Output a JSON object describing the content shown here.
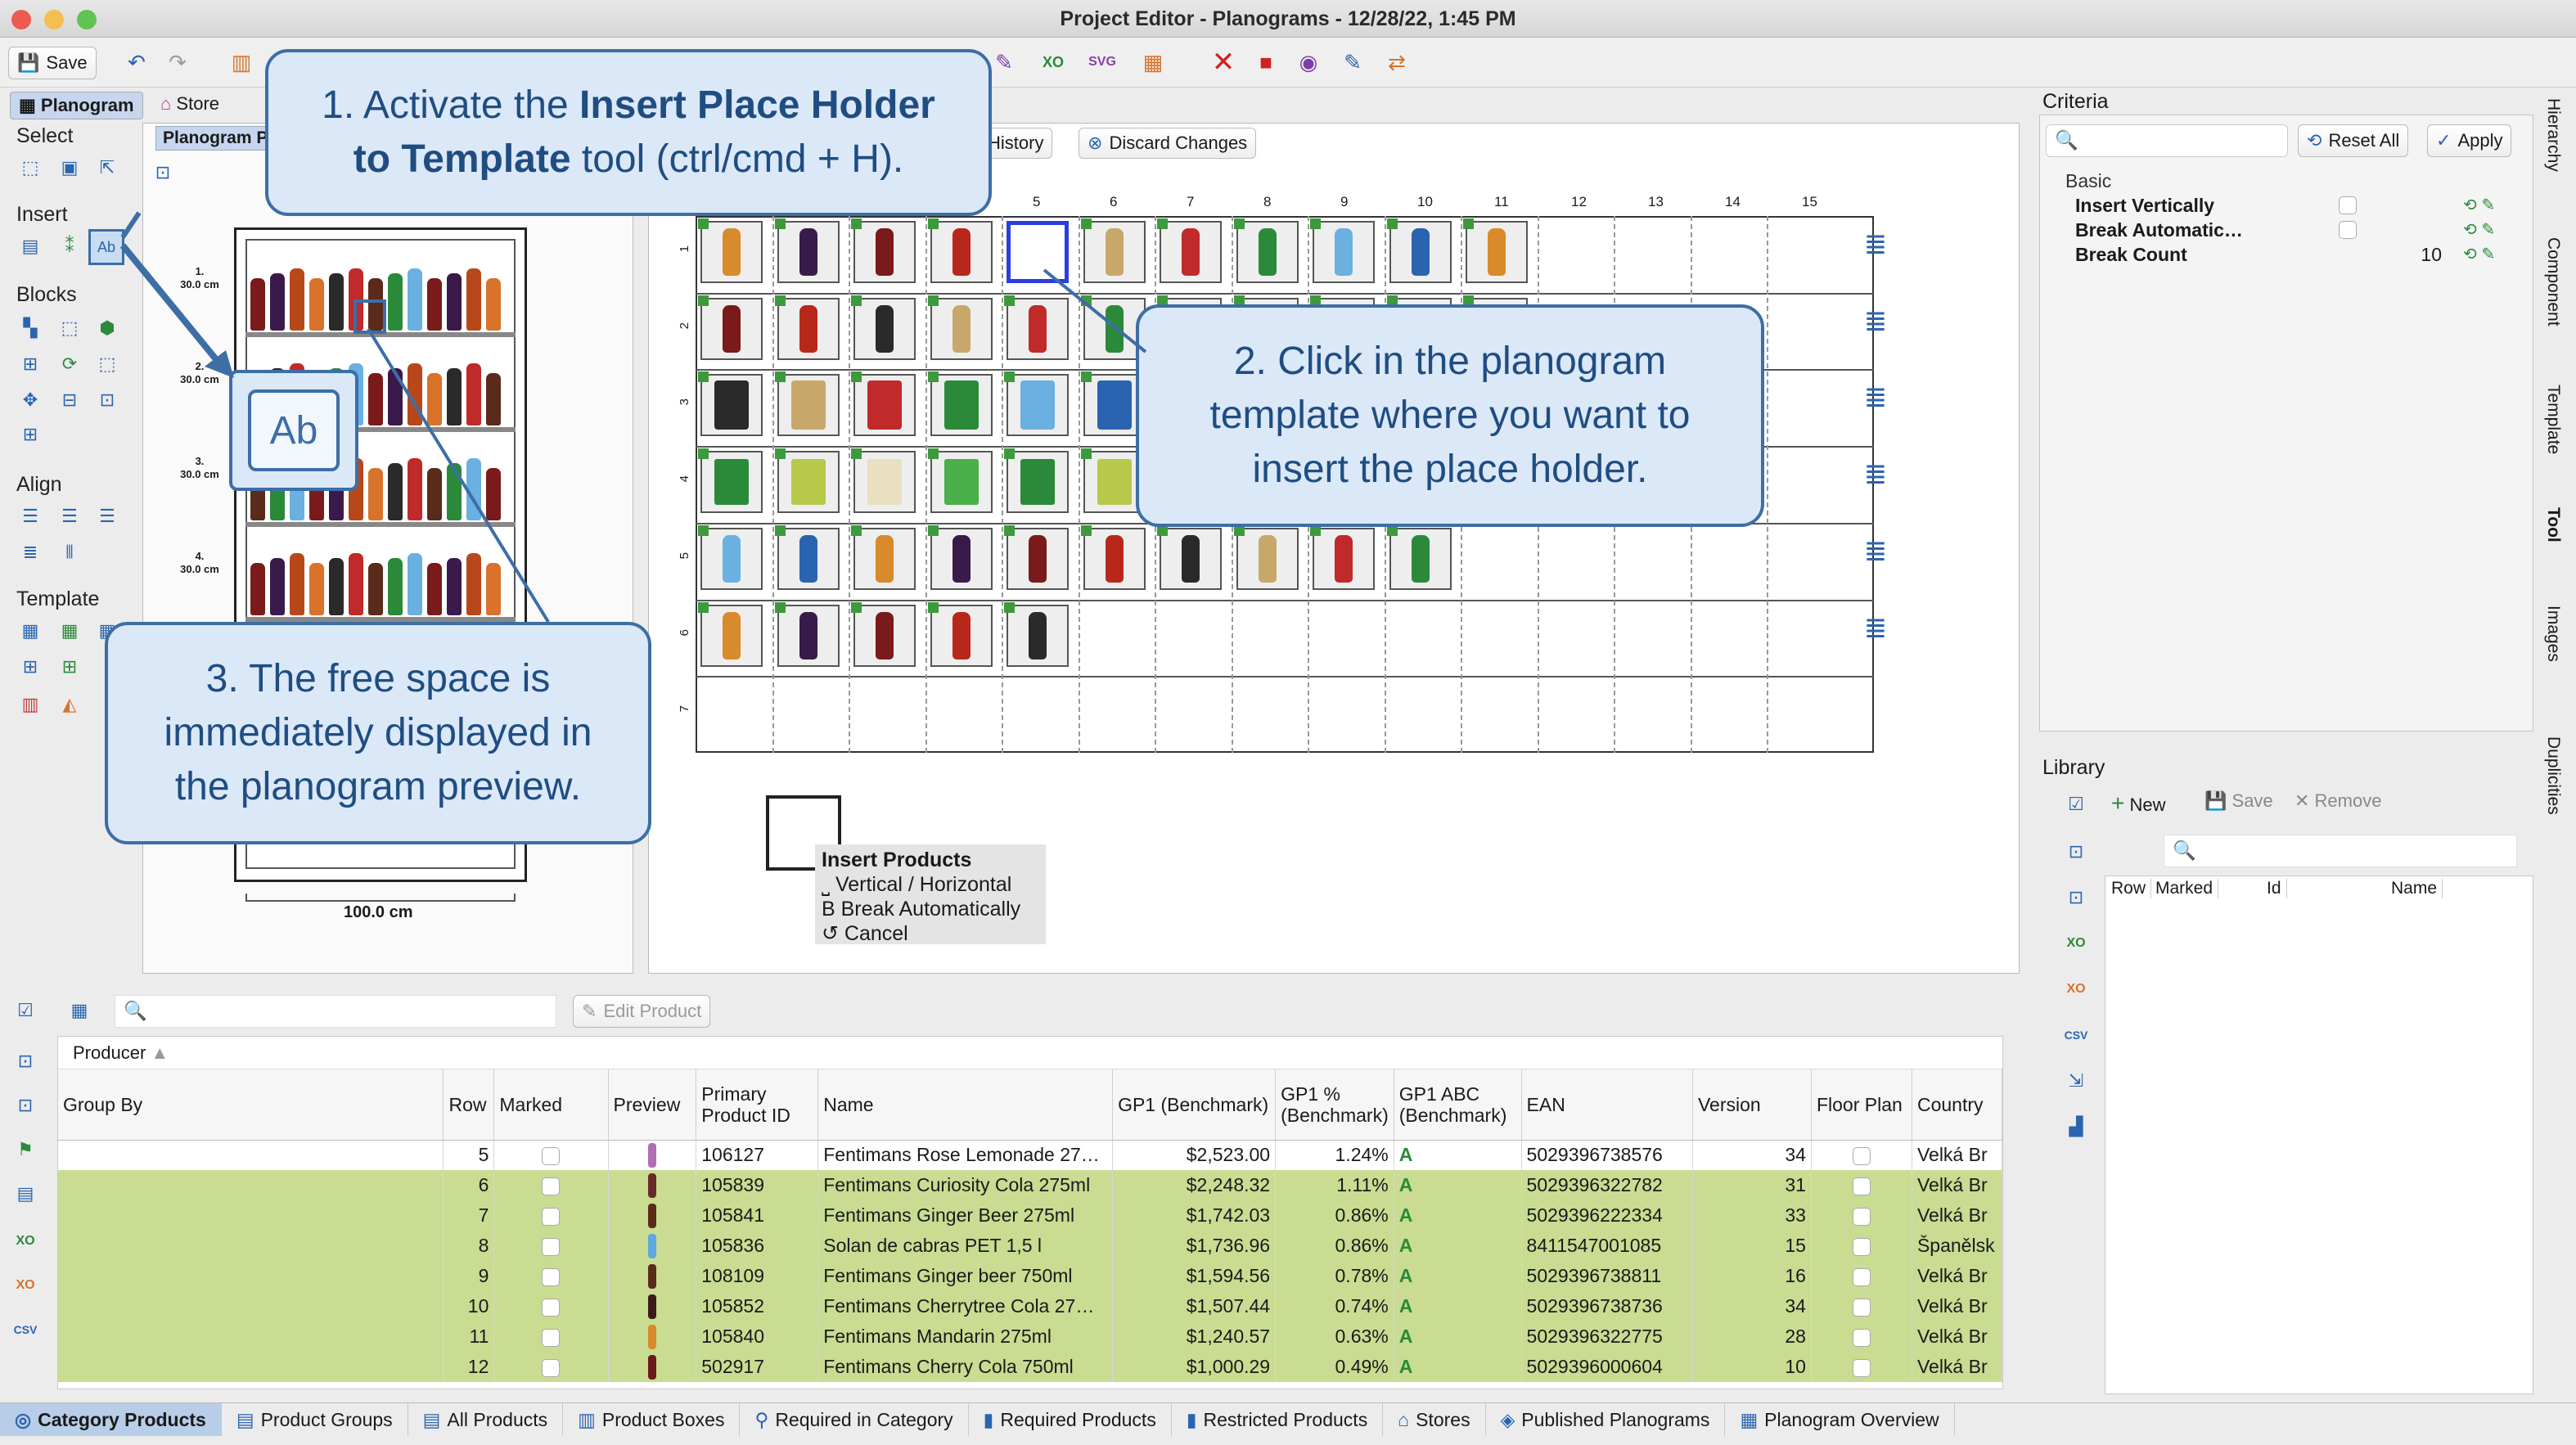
{
  "window": {
    "title": "Project Editor - Planograms - 12/28/22, 1:45 PM"
  },
  "toolbar": {
    "save_label": "Save",
    "history_label": "History",
    "discard_label": "Discard Changes"
  },
  "tabs": {
    "planogram": "Planogram",
    "store": "Store",
    "planogram_sub": "Planogram P"
  },
  "sections": {
    "select": "Select",
    "insert": "Insert",
    "blocks": "Blocks",
    "align": "Align",
    "template": "Template"
  },
  "callouts": {
    "c1_pre": "1. Activate the ",
    "c1_bold": "Insert Place Holder",
    "c1_bold2": "to Template",
    "c1_post": " tool (ctrl/cmd + H).",
    "c2_l1": "2. Click in the planogram",
    "c2_l2": "template where you want to",
    "c2_l3": "insert the place holder.",
    "c3_l1": "3. The free space is",
    "c3_l2": "immediately displayed in",
    "c3_l3": "the planogram preview."
  },
  "preview": {
    "width_label": "100.0 cm",
    "shelves": [
      {
        "num": "1.",
        "h": "30.0 cm"
      },
      {
        "num": "2.",
        "h": "30.0 cm"
      },
      {
        "num": "3.",
        "h": "30.0 cm"
      },
      {
        "num": "4.",
        "h": "30.0 cm"
      }
    ],
    "ab_label": "Ab"
  },
  "template": {
    "columns": [
      "5",
      "6",
      "7",
      "8",
      "9",
      "10",
      "11",
      "12",
      "13",
      "14",
      "15"
    ],
    "rows": [
      "1",
      "2",
      "3",
      "4",
      "5",
      "6",
      "7"
    ],
    "popup": {
      "title": "Insert Products",
      "items": [
        "⎵ Vertical / Horizontal",
        "B Break Automatically",
        "↺ Cancel"
      ]
    }
  },
  "criteria": {
    "title": "Criteria",
    "reset": "Reset All",
    "apply": "Apply",
    "group": "Basic",
    "items": [
      {
        "label": "Insert Vertically",
        "value": ""
      },
      {
        "label": "Break Automatic…",
        "value": ""
      },
      {
        "label": "Break Count",
        "value": "10"
      }
    ]
  },
  "library": {
    "title": "Library",
    "new": "New",
    "save": "Save",
    "remove": "Remove",
    "columns": [
      "Row",
      "Marked",
      "Id",
      "Name"
    ]
  },
  "products": {
    "edit_label": "Edit Product",
    "groupby_chip": "Producer",
    "groupby_label": "Group By",
    "columns": [
      "Row",
      "Marked",
      "Preview",
      "Primary Product ID",
      "Name",
      "GP1 (Benchmark)",
      "GP1 % (Benchmark)",
      "GP1 ABC (Benchmark)",
      "EAN",
      "Version",
      "Floor Plan",
      "Country"
    ],
    "sort_index": "1",
    "rows": [
      {
        "row": "5",
        "id": "106127",
        "name": "Fentimans Rose Lemonade 27…",
        "gp1": "$2,523.00",
        "pct": "1.24%",
        "abc": "A",
        "ean": "5029396738576",
        "ver": "34",
        "country": "Velká Br",
        "hl": false,
        "color": "#b36db3"
      },
      {
        "row": "6",
        "id": "105839",
        "name": "Fentimans Curiosity Cola 275ml",
        "gp1": "$2,248.32",
        "pct": "1.11%",
        "abc": "A",
        "ean": "5029396322782",
        "ver": "31",
        "country": "Velká Br",
        "hl": true,
        "color": "#6b2a2a"
      },
      {
        "row": "7",
        "id": "105841",
        "name": "Fentimans Ginger Beer 275ml",
        "gp1": "$1,742.03",
        "pct": "0.86%",
        "abc": "A",
        "ean": "5029396222334",
        "ver": "33",
        "country": "Velká Br",
        "hl": true,
        "color": "#5a2a1a"
      },
      {
        "row": "8",
        "id": "105836",
        "name": "Solan de cabras PET 1,5 l",
        "gp1": "$1,736.96",
        "pct": "0.86%",
        "abc": "A",
        "ean": "8411547001085",
        "ver": "15",
        "country": "Španělsk",
        "hl": true,
        "color": "#5fa8e0"
      },
      {
        "row": "9",
        "id": "108109",
        "name": "Fentimans Ginger beer 750ml",
        "gp1": "$1,594.56",
        "pct": "0.78%",
        "abc": "A",
        "ean": "5029396738811",
        "ver": "16",
        "country": "Velká Br",
        "hl": true,
        "color": "#5a2a1a"
      },
      {
        "row": "10",
        "id": "105852",
        "name": "Fentimans Cherrytree Cola 27…",
        "gp1": "$1,507.44",
        "pct": "0.74%",
        "abc": "A",
        "ean": "5029396738736",
        "ver": "34",
        "country": "Velká Br",
        "hl": true,
        "color": "#3a1a1a"
      },
      {
        "row": "11",
        "id": "105840",
        "name": "Fentimans Mandarin 275ml",
        "gp1": "$1,240.57",
        "pct": "0.63%",
        "abc": "A",
        "ean": "5029396322775",
        "ver": "28",
        "country": "Velká Br",
        "hl": true,
        "color": "#d98a2a"
      },
      {
        "row": "12",
        "id": "502917",
        "name": "Fentimans Cherry Cola 750ml",
        "gp1": "$1,000.29",
        "pct": "0.49%",
        "abc": "A",
        "ean": "5029396000604",
        "ver": "10",
        "country": "Velká Br",
        "hl": true,
        "color": "#6a1a1a"
      }
    ]
  },
  "bottom_tabs": [
    "Category Products",
    "Product Groups",
    "All Products",
    "Product Boxes",
    "Required in Category",
    "Required Products",
    "Restricted Products",
    "Stores",
    "Published Planograms",
    "Planogram Overview"
  ],
  "side_tabs": [
    "Hierarchy",
    "Component",
    "Template",
    "Tool",
    "Images",
    "Duplicities"
  ],
  "colors": {
    "accent": "#2a64b0",
    "callout_border": "#3d6ea6",
    "callout_fill": "#dbe8f7",
    "row_highlight": "#c9dc92",
    "marker": "#3c9a3c"
  }
}
